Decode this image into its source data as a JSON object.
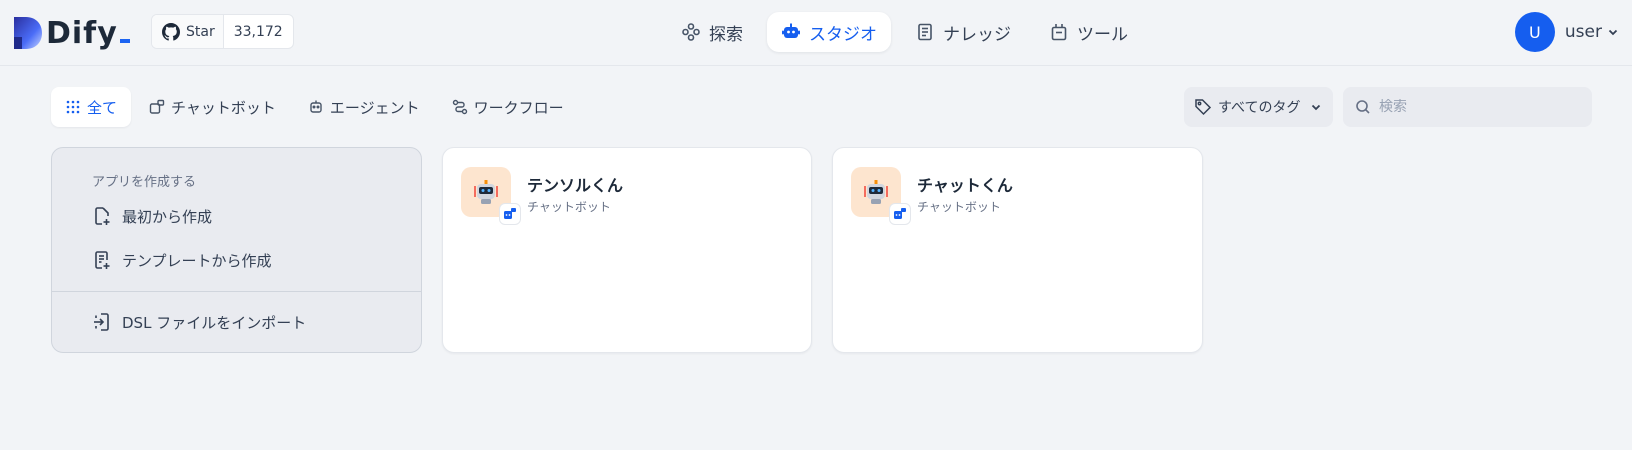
{
  "header": {
    "logo_text": "Dify",
    "github": {
      "star_label": "Star",
      "star_count": "33,172",
      "icon": "github-icon"
    },
    "nav": [
      {
        "label": "探索",
        "icon": "explore-icon",
        "active": false
      },
      {
        "label": "スタジオ",
        "icon": "robot-icon",
        "active": true
      },
      {
        "label": "ナレッジ",
        "icon": "book-icon",
        "active": false
      },
      {
        "label": "ツール",
        "icon": "briefcase-icon",
        "active": false
      }
    ],
    "user": {
      "avatar_initial": "U",
      "name": "user"
    }
  },
  "filters": {
    "tabs": [
      {
        "label": "全て",
        "icon": "grid-dots-icon",
        "active": true
      },
      {
        "label": "チャットボット",
        "icon": "chat-bot-icon",
        "active": false
      },
      {
        "label": "エージェント",
        "icon": "agent-icon",
        "active": false
      },
      {
        "label": "ワークフロー",
        "icon": "workflow-icon",
        "active": false
      }
    ],
    "tag_select": {
      "label": "すべてのタグ",
      "icon": "tag-icon"
    },
    "search": {
      "placeholder": "検索",
      "value": ""
    }
  },
  "create_card": {
    "title": "アプリを作成する",
    "items": [
      {
        "label": "最初から作成",
        "icon": "file-plus-icon"
      },
      {
        "label": "テンプレートから作成",
        "icon": "template-icon"
      },
      {
        "label": "DSL ファイルをインポート",
        "icon": "import-icon"
      }
    ]
  },
  "apps": [
    {
      "name": "テンソルくん",
      "type": "チャットボット",
      "icon": "robot-avatar-icon",
      "badge": "chat-bot-badge-icon"
    },
    {
      "name": "チャットくん",
      "type": "チャットボット",
      "icon": "robot-avatar-icon",
      "badge": "chat-bot-badge-icon"
    }
  ],
  "colors": {
    "accent": "#155eef",
    "background": "#f2f4f7",
    "app_icon_bg": "#fde5cf"
  }
}
